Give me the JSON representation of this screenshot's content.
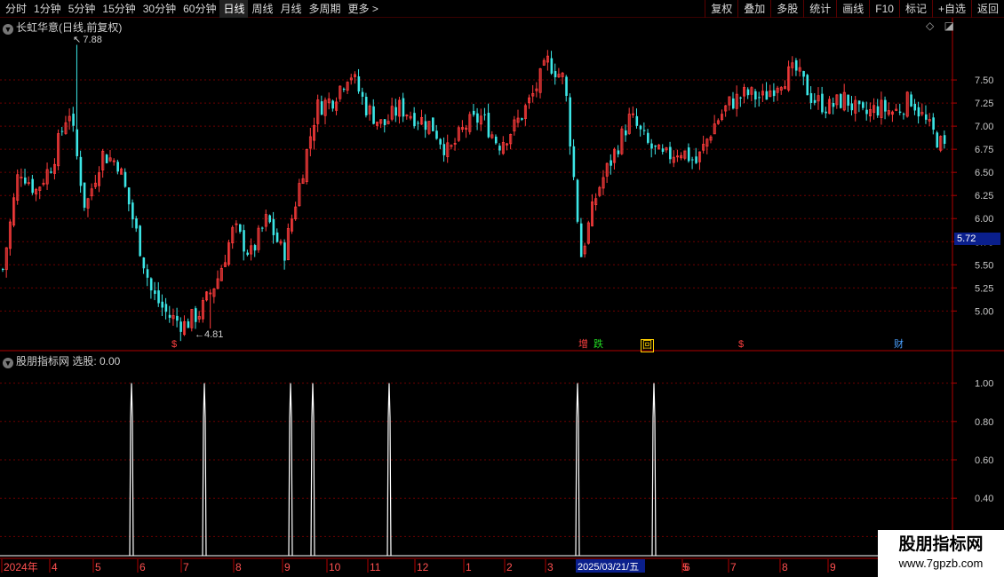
{
  "toolbar": {
    "periods": [
      "分时",
      "1分钟",
      "5分钟",
      "15分钟",
      "30分钟",
      "60分钟",
      "日线",
      "周线",
      "月线",
      "多周期",
      "更多 >"
    ],
    "active_period": "日线",
    "right_buttons": [
      "复权",
      "叠加",
      "多股",
      "统计",
      "画线",
      "F10",
      "标记",
      "+自选",
      "返回"
    ]
  },
  "main_panel": {
    "title": "长虹华意(日线,前复权)",
    "high_label": "7.88",
    "low_label": "4.81",
    "current_price": "5.72"
  },
  "indicator_panel": {
    "title": "股朋指标网 选股: 0.00"
  },
  "markers": {
    "dollar1": "$",
    "zeng": "增",
    "die": "跌",
    "hui": "回",
    "dollar2": "$",
    "cai": "财"
  },
  "date_axis": {
    "highlight_date": "2025/03/21/五",
    "labels": [
      "2024年",
      "4",
      "5",
      "6",
      "7",
      "8",
      "9",
      "10",
      "11",
      "12",
      "1",
      "2",
      "3",
      "5",
      "6",
      "7",
      "8",
      "9"
    ]
  },
  "watermark": {
    "title": "股朋指标网",
    "url": "www.7gpzb.com"
  },
  "colors": {
    "up": "#ff3c3c",
    "down": "#3ce6e6",
    "grid": "#6e0000",
    "axis": "#b00000",
    "signal": "#ffffff",
    "price_tag": "#0a1f8c"
  },
  "chart_data": [
    {
      "type": "candlestick",
      "title": "长虹华意(日线,前复权)",
      "ylim": [
        4.6,
        8.0
      ],
      "y_ticks": [
        5.0,
        5.25,
        5.5,
        5.75,
        6.0,
        6.25,
        6.5,
        6.75,
        7.0,
        7.25,
        7.5
      ],
      "x_tick_labels": [
        "2024年",
        "4",
        "5",
        "6",
        "7",
        "8",
        "9",
        "10",
        "11",
        "12",
        "1",
        "2",
        "3",
        "2025/03/21/五",
        "5",
        "6",
        "7",
        "8",
        "9"
      ],
      "trend_closes": [
        5.45,
        6.55,
        6.3,
        6.6,
        7.2,
        6.1,
        6.7,
        6.6,
        5.9,
        5.2,
        4.95,
        4.85,
        5.0,
        5.35,
        5.9,
        5.6,
        6.0,
        5.6,
        6.4,
        7.2,
        7.3,
        7.6,
        7.2,
        7.0,
        7.2,
        7.1,
        7.0,
        6.7,
        7.0,
        7.1,
        6.8,
        7.0,
        7.3,
        7.7,
        7.5,
        5.6,
        6.3,
        6.7,
        7.1,
        6.8,
        6.65,
        6.75,
        6.6,
        7.0,
        7.25,
        7.35,
        7.3,
        7.5,
        7.6,
        7.3,
        7.2,
        7.3,
        7.1,
        7.2,
        7.15,
        7.3,
        7.0,
        6.75
      ],
      "high": 7.88,
      "low": 4.81,
      "last_price": 5.72
    },
    {
      "type": "line",
      "title": "股朋指标网 选股: 0.00",
      "ylim": [
        0.1,
        1.1
      ],
      "y_ticks": [
        0.2,
        0.4,
        0.6,
        0.8,
        1.0
      ],
      "signal_values": [
        1,
        1,
        1,
        1,
        1,
        1,
        1
      ],
      "current_value": 0.0
    }
  ]
}
